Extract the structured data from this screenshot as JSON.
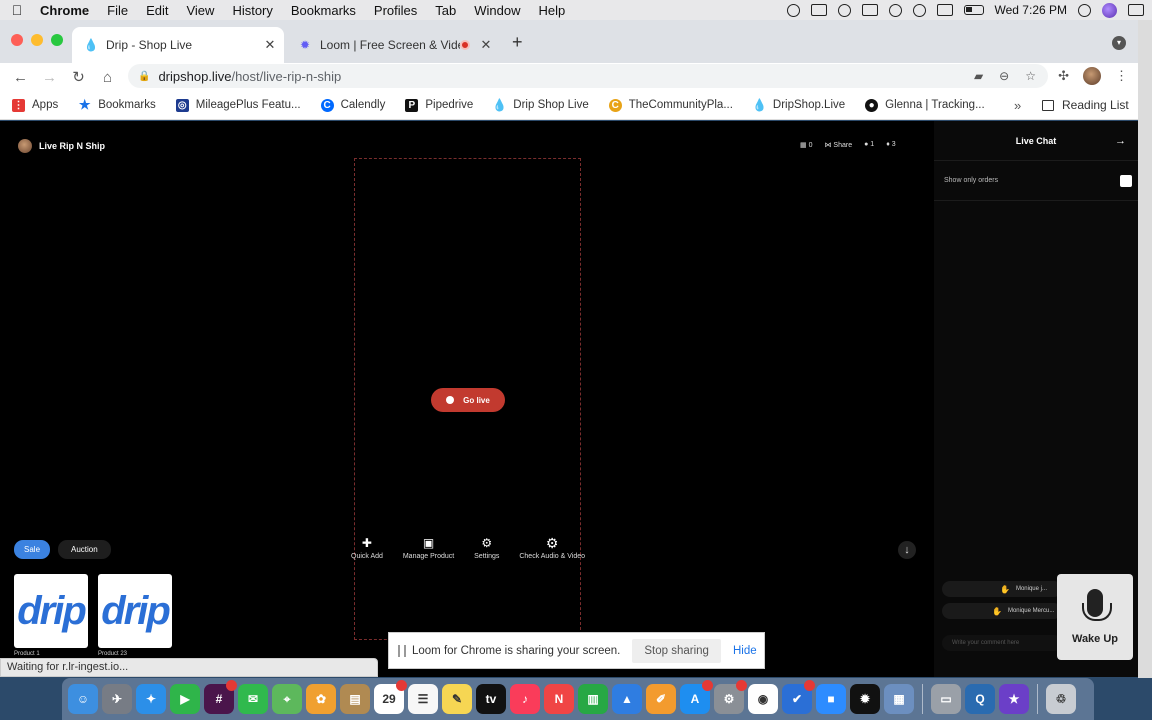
{
  "menubar": {
    "apple": "",
    "app_name": "Chrome",
    "items": [
      "File",
      "Edit",
      "View",
      "History",
      "Bookmarks",
      "Profiles",
      "Tab",
      "Window",
      "Help"
    ],
    "clock": "Wed 7:26 PM"
  },
  "tabs": [
    {
      "title": "Drip - Shop Live",
      "icon": "drip-drop-icon"
    },
    {
      "title": "Loom | Free Screen & Vide",
      "icon": "loom-icon"
    }
  ],
  "address": {
    "host": "dripshop.live",
    "path": "/host/live-rip-n-ship"
  },
  "bookmarks": {
    "items": [
      {
        "label": "Apps",
        "icon": "apps-grid-icon",
        "color": "#e53935"
      },
      {
        "label": "Bookmarks",
        "icon": "star-icon",
        "color": "#1a73e8"
      },
      {
        "label": "MileagePlus Featu...",
        "icon": "united-icon",
        "color": "#1d3b8f"
      },
      {
        "label": "Calendly",
        "icon": "calendly-icon",
        "color": "#0069ff"
      },
      {
        "label": "Pipedrive",
        "icon": "pipedrive-icon",
        "color": "#111111"
      },
      {
        "label": "Drip Shop Live",
        "icon": "drip-drop-icon",
        "color": "#2b8ae6"
      },
      {
        "label": "TheCommunityPla...",
        "icon": "community-icon",
        "color": "#e8a317"
      },
      {
        "label": "DripShop.Live",
        "icon": "drip-drop-icon",
        "color": "#2b8ae6"
      },
      {
        "label": "Glenna | Tracking...",
        "icon": "tracking-icon",
        "color": "#111111"
      }
    ],
    "more": "»",
    "reading_list": "Reading List"
  },
  "stream": {
    "channel_name": "Live Rip N Ship",
    "stats": {
      "bids": "0",
      "share": "Share",
      "viewers": "1",
      "likes": "3"
    },
    "go_live": "Go live",
    "tools": [
      {
        "label": "Quick Add",
        "icon": "bag-plus-icon",
        "glyph": "✚"
      },
      {
        "label": "Manage Product",
        "icon": "bag-icon",
        "glyph": "▣"
      },
      {
        "label": "Settings",
        "icon": "gear-icon",
        "glyph": "⚙"
      },
      {
        "label": "Check Audio & Video",
        "icon": "gear-check-icon",
        "glyph": "⚙"
      }
    ],
    "modes": [
      "Sale",
      "Auction"
    ],
    "products": [
      {
        "name": "Product 1",
        "logo": "drip"
      },
      {
        "name": "Product 23",
        "logo": "drip"
      }
    ]
  },
  "chat": {
    "title": "Live Chat",
    "filter_label": "Show only orders",
    "messages": [
      "Monique j...",
      "Monique Mercu..."
    ],
    "comment_placeholder": "Write your comment here"
  },
  "wake": {
    "label": "Wake Up"
  },
  "loom": {
    "message": "Loom for Chrome is sharing your screen.",
    "stop": "Stop sharing",
    "hide": "Hide"
  },
  "status": "Waiting for r.lr-ingest.io...",
  "dock": [
    {
      "name": "finder",
      "color": "#3d8fe0",
      "glyph": "☺"
    },
    {
      "name": "launchpad",
      "color": "#777c85",
      "glyph": "✈"
    },
    {
      "name": "safari",
      "color": "#2c8fe8",
      "glyph": "✦"
    },
    {
      "name": "facetime",
      "color": "#2fb54a",
      "glyph": "▶"
    },
    {
      "name": "slack",
      "color": "#4a154b",
      "glyph": "#",
      "badge": true
    },
    {
      "name": "messages",
      "color": "#30b94d",
      "glyph": "✉"
    },
    {
      "name": "maps",
      "color": "#5db85c",
      "glyph": "⌖"
    },
    {
      "name": "photos",
      "color": "#f0a030",
      "glyph": "✿"
    },
    {
      "name": "notes-brown",
      "color": "#b08a52",
      "glyph": "▤"
    },
    {
      "name": "calendar",
      "color": "#ffffff",
      "glyph": "29",
      "dark": true,
      "badge": true
    },
    {
      "name": "reminders",
      "color": "#f7f7f7",
      "glyph": "☰",
      "dark": true
    },
    {
      "name": "notes",
      "color": "#f6d653",
      "glyph": "✎",
      "dark": true
    },
    {
      "name": "appletv",
      "color": "#111111",
      "glyph": "tv"
    },
    {
      "name": "music",
      "color": "#fa3c5a",
      "glyph": "♪"
    },
    {
      "name": "news",
      "color": "#f04545",
      "glyph": "N"
    },
    {
      "name": "numbers",
      "color": "#27a845",
      "glyph": "▥"
    },
    {
      "name": "keynote",
      "color": "#2f7de1",
      "glyph": "▲"
    },
    {
      "name": "pages",
      "color": "#f39b2e",
      "glyph": "✐"
    },
    {
      "name": "appstore",
      "color": "#1e8ef0",
      "glyph": "A",
      "badge": true
    },
    {
      "name": "system-preferences",
      "color": "#8a8f96",
      "glyph": "⚙",
      "badge": true
    },
    {
      "name": "chrome",
      "color": "#ffffff",
      "glyph": "◉",
      "dark": true
    },
    {
      "name": "tasks",
      "color": "#2b6fd6",
      "glyph": "✔",
      "badge": true
    },
    {
      "name": "zoom",
      "color": "#2d8cff",
      "glyph": "■"
    },
    {
      "name": "loom",
      "color": "#111111",
      "glyph": "✹"
    },
    {
      "name": "preview",
      "color": "#6c8fc0",
      "glyph": "▦"
    },
    {
      "name": "archive",
      "color": "#9aa0a8",
      "glyph": "▭"
    },
    {
      "name": "quicktime",
      "color": "#2a6bb0",
      "glyph": "Q"
    },
    {
      "name": "imovie",
      "color": "#6b3fc8",
      "glyph": "★"
    },
    {
      "name": "trash",
      "color": "#c8ccd2",
      "glyph": "♲",
      "dark": true
    }
  ],
  "colors": {
    "go_live": "#c23a2f",
    "sale_tab": "#3b82e0",
    "drip_blue": "#2b6fd6"
  }
}
